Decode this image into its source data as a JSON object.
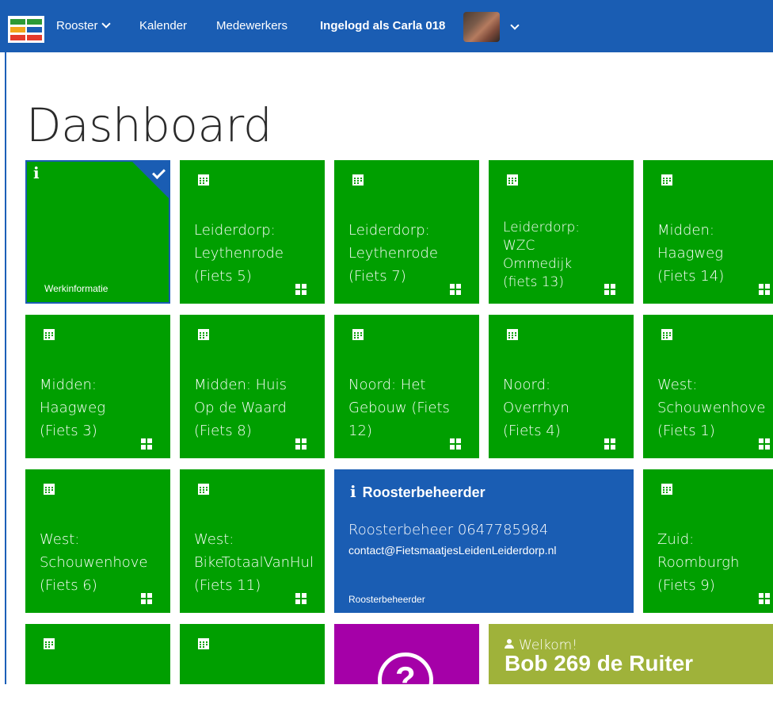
{
  "nav": {
    "rooster": "Rooster",
    "kalender": "Kalender",
    "medewerkers": "Medewerkers",
    "user": "Ingelogd als Carla 018"
  },
  "page_title": "Dashboard",
  "tiles": [
    {
      "label": "Werkinformatie"
    },
    {
      "label": "Leiderdorp:\nLeythenrode\n(Fiets 5)"
    },
    {
      "label": "Leiderdorp:\nLeythenrode\n(Fiets 7)"
    },
    {
      "label": "Leiderdorp:\nWZC\nOmmedijk\n(fiets 13)"
    },
    {
      "label": "Midden:\nHaagweg\n(Fiets 14)"
    },
    {
      "label": "Midden:\nHaagweg\n(Fiets 3)"
    },
    {
      "label": "Midden: Huis\nOp de Waard\n(Fiets 8)"
    },
    {
      "label": "Noord: Het\nGebouw (Fiets\n12)"
    },
    {
      "label": "Noord:\nOverrhyn\n(Fiets 4)"
    },
    {
      "label": "West:\nSchouwenhove\n(Fiets 1)"
    },
    {
      "label": "West:\nSchouwenhove\n(Fiets 6)"
    },
    {
      "label": "West:\nBikeTotaalVanHul\n(Fiets 11)"
    },
    {
      "label": "Zuid:\nRoomburgh\n(Fiets 9)"
    }
  ],
  "rooster_tile": {
    "title": "Roosterbeheerder",
    "phone": "Roosterbeheer 0647785984",
    "email": "contact@FietsmaatjesLeidenLeiderdorp.nl",
    "footer": "Roosterbeheerder"
  },
  "welcome": {
    "greeting": "Welkom!",
    "name": "Bob 269 de Ruiter"
  },
  "colors": {
    "nav": "#1a5db3",
    "tile_green": "#009f00",
    "tile_blue": "#1a5db3",
    "tile_purple": "#a500a8",
    "tile_olive": "#9fb23a"
  }
}
